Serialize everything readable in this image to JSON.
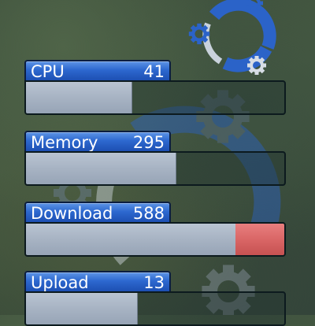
{
  "meters": [
    {
      "label": "CPU",
      "value": "41",
      "fill": 0.41,
      "alert": 0
    },
    {
      "label": "Memory",
      "value": "295",
      "fill": 0.58,
      "alert": 0
    },
    {
      "label": "Download",
      "value": "588",
      "fill": 0.81,
      "alert": 0.19
    },
    {
      "label": "Upload",
      "value": "13",
      "fill": 0.43,
      "alert": 0
    }
  ],
  "colors": {
    "header_blue": "#2d68cf",
    "fill_grey": "#a7b3c3",
    "alert_red": "#d86464",
    "logo_blue": "#2b63c8"
  }
}
